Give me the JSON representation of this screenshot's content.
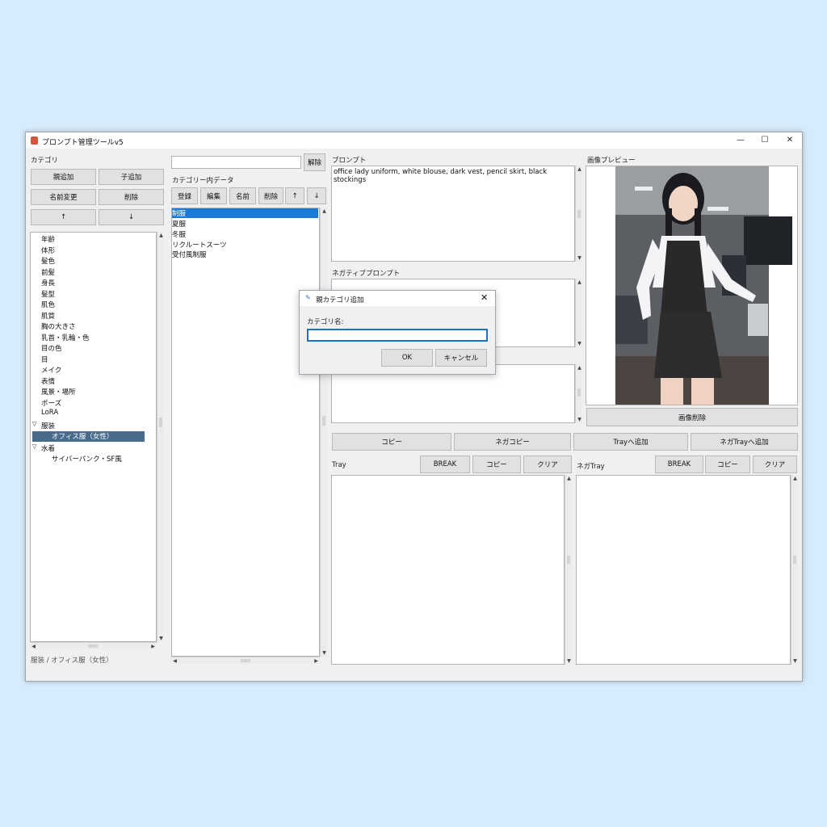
{
  "window": {
    "title": "プロンプト管理ツールv5",
    "controls": [
      "—",
      "☐",
      "✕"
    ]
  },
  "category_panel": {
    "label": "カテゴリ",
    "buttons": {
      "add_parent": "親追加",
      "add_child": "子追加",
      "rename": "名前変更",
      "delete": "削除",
      "up": "↑",
      "down": "↓"
    },
    "tree": [
      "年齢",
      "体形",
      "髪色",
      "前髪",
      "身長",
      "髪型",
      "肌色",
      "肌質",
      "胸の大きさ",
      "乳首・乳輪・色",
      "目の色",
      "目",
      "メイク",
      "表情",
      "風景・場所",
      "ポーズ",
      "LoRA"
    ],
    "tree_groups": {
      "clothing": "服装",
      "clothing_child": "オフィス服（女性）",
      "swimwear": "水着",
      "swimwear_child": "サイバーパンク・SF風"
    },
    "breadcrumb": "服装 / オフィス服（女性）"
  },
  "data_panel": {
    "search_value": "",
    "clear_button": "解除",
    "label": "カテゴリー内データ",
    "buttons": {
      "register": "登録",
      "edit": "編集",
      "name": "名前",
      "delete": "削除",
      "up": "↑",
      "down": "↓"
    },
    "items": [
      "制服",
      "夏服",
      "冬服",
      "リクルートスーツ",
      "受付風制服"
    ]
  },
  "prompt_panel": {
    "label": "プロンプト",
    "text": "office lady uniform, white blouse, dark vest, pencil skirt, black stockings",
    "negative_label": "ネガティブプロンプト",
    "negative_text": "",
    "buttons": {
      "copy": "コピー",
      "nega_copy": "ネガコピー",
      "add_tray": "Trayへ追加",
      "add_nega_tray": "ネガTrayへ追加"
    }
  },
  "tray": {
    "label": "Tray",
    "break": "BREAK",
    "copy": "コピー",
    "clear": "クリア",
    "content": ""
  },
  "nega_tray": {
    "label": "ネガTray",
    "break": "BREAK",
    "copy": "コピー",
    "clear": "クリア",
    "content": ""
  },
  "preview": {
    "label": "画像プレビュー",
    "delete_button": "画像削除"
  },
  "dialog": {
    "title": "親カテゴリ追加",
    "field_label": "カテゴリ名:",
    "value": "",
    "ok": "OK",
    "cancel": "キャンセル"
  }
}
